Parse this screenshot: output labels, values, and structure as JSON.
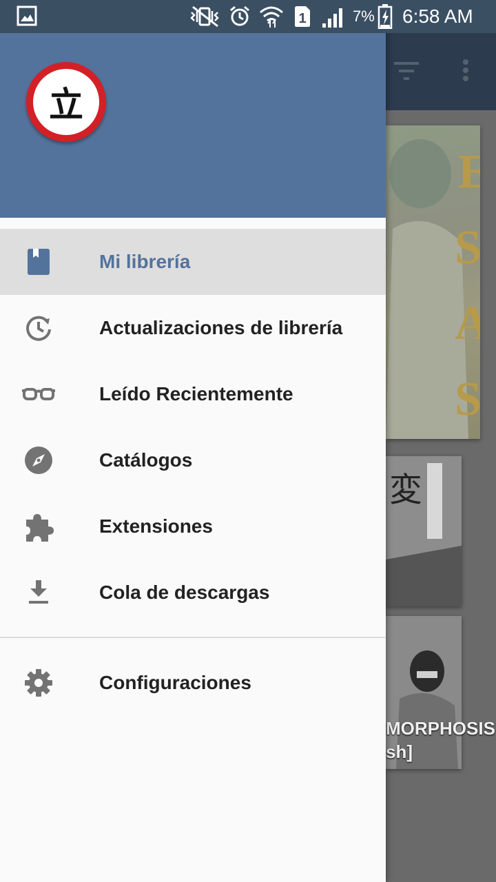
{
  "status_bar": {
    "battery_percent": "7%",
    "time": "6:58 AM",
    "icons": [
      "gallery-notification-icon",
      "vibrate-mute-icon",
      "alarm-icon",
      "wifi-icon",
      "sim-1-icon",
      "signal-icon",
      "battery-charging-icon"
    ]
  },
  "drawer": {
    "logo_glyph": "立",
    "items": [
      {
        "label": "Mi librería",
        "icon": "bookmark-book-icon",
        "active": true
      },
      {
        "label": "Actualizaciones de librería",
        "icon": "update-history-icon",
        "active": false
      },
      {
        "label": "Leído Recientemente",
        "icon": "glasses-icon",
        "active": false
      },
      {
        "label": "Catálogos",
        "icon": "compass-icon",
        "active": false
      },
      {
        "label": "Extensiones",
        "icon": "puzzle-icon",
        "active": false
      },
      {
        "label": "Cola de descargas",
        "icon": "download-icon",
        "active": false
      }
    ],
    "settings": {
      "label": "Configuraciones",
      "icon": "gear-icon"
    }
  },
  "background": {
    "toolbar_icons": [
      "filter-icon",
      "more-vert-icon"
    ],
    "manga_title_fragment": [
      "MORPHOSIS",
      "sh]"
    ]
  },
  "colors": {
    "header": "#54739c",
    "active_label": "#54739c",
    "active_bg": "#dedede",
    "status_bar": "#3b4f63",
    "logo_ring": "#d32027"
  }
}
